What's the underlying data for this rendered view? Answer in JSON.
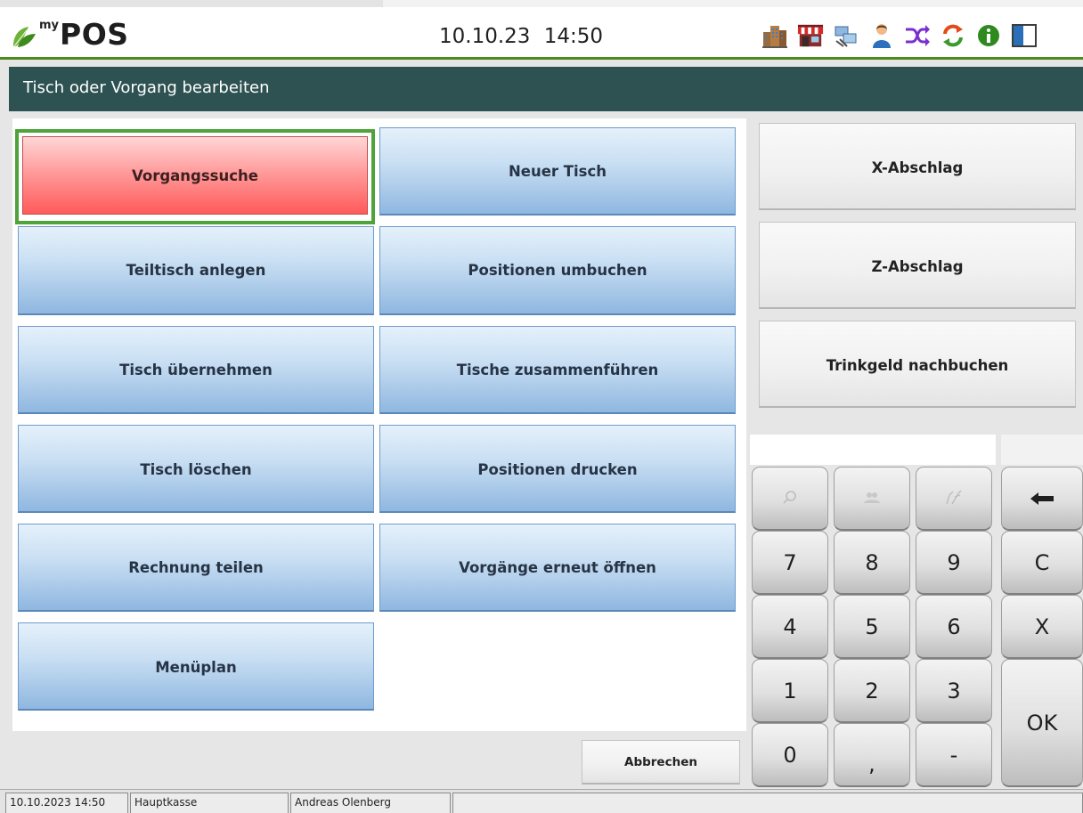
{
  "header": {
    "logo_small": "my",
    "logo_big": "POS",
    "clock": "10.10.23  14:50",
    "icons": [
      "building-icon",
      "shop-icon",
      "network-icon",
      "user-icon",
      "shuffle-icon",
      "refresh-icon",
      "info-icon",
      "panel-toggle-icon"
    ]
  },
  "title": "Tisch oder Vorgang bearbeiten",
  "actions": {
    "vorgangssuche": "Vorgangssuche",
    "neuer_tisch": "Neuer Tisch",
    "teiltisch_anlegen": "Teiltisch anlegen",
    "positionen_umbuchen": "Positionen umbuchen",
    "tisch_uebernehmen": "Tisch übernehmen",
    "tische_zusammenfuehren": "Tische zusammenführen",
    "tisch_loeschen": "Tisch löschen",
    "positionen_drucken": "Positionen drucken",
    "rechnung_teilen": "Rechnung teilen",
    "vorgaenge_oeffnen": "Vorgänge erneut öffnen",
    "menueplan": "Menüplan"
  },
  "right_actions": {
    "x_abschlag": "X-Abschlag",
    "z_abschlag": "Z-Abschlag",
    "trinkgeld": "Trinkgeld nachbuchen"
  },
  "cancel_label": "Abbrechen",
  "numpad": {
    "k7": "7",
    "k8": "8",
    "k9": "9",
    "clear": "C",
    "k4": "4",
    "k5": "5",
    "k6": "6",
    "times": "X",
    "k1": "1",
    "k2": "2",
    "k3": "3",
    "ok": "OK",
    "k0": "0",
    "comma": ",",
    "minus": "-"
  },
  "status": {
    "datetime": "10.10.2023 14:50",
    "register": "Hauptkasse",
    "user": "Andreas Olenberg"
  },
  "colors": {
    "title_bar": "#2e5252",
    "header_line": "#4e8a1b",
    "selected_border": "#4ea33a",
    "primary_red": "#ff5a5a",
    "primary_blue": "#8fb7e0"
  }
}
